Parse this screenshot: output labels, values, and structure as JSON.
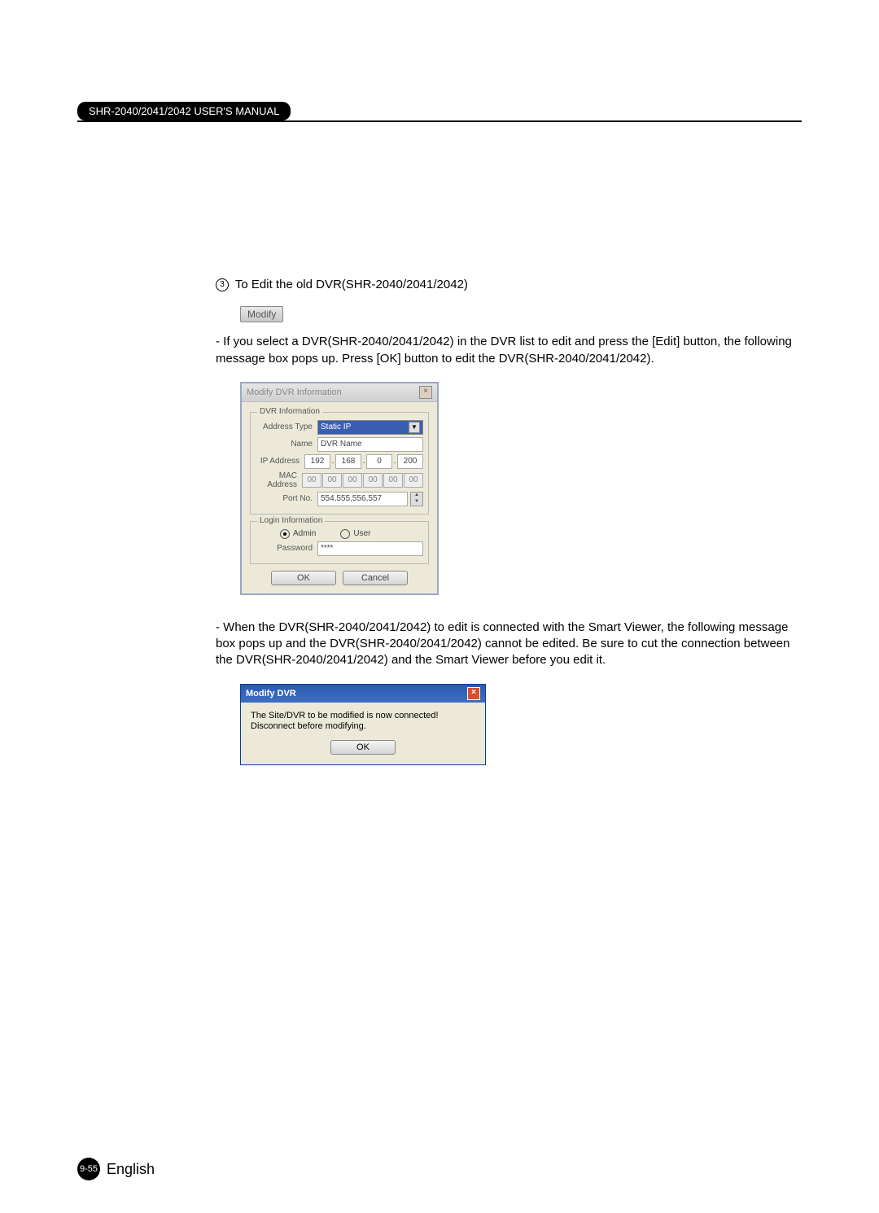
{
  "header": {
    "manual_title": "SHR-2040/2041/2042 USER'S MANUAL"
  },
  "section": {
    "step_number": "3",
    "step_title": "To Edit the old DVR(SHR-2040/2041/2042)",
    "modify_button_label": "Modify",
    "para1": "- If you select a DVR(SHR-2040/2041/2042) in the DVR list to edit and press the [Edit] button, the following message box pops up. Press [OK] button to edit the DVR(SHR-2040/2041/2042).",
    "para2": "- When the DVR(SHR-2040/2041/2042) to edit is connected with the Smart Viewer, the following message box pops up and the DVR(SHR-2040/2041/2042) cannot be edited. Be sure to cut the connection between the DVR(SHR-2040/2041/2042) and the Smart Viewer before you edit it."
  },
  "dialog1": {
    "title": "Modify DVR Information",
    "group1_legend": "DVR Information",
    "address_type_label": "Address Type",
    "address_type_value": "Static IP",
    "name_label": "Name",
    "name_value": "DVR Name",
    "ip_label": "IP Address",
    "ip": [
      "192",
      "168",
      "0",
      "200"
    ],
    "mac_label": "MAC Address",
    "mac": [
      "00",
      "00",
      "00",
      "00",
      "00",
      "00"
    ],
    "port_label": "Port No.",
    "port_value": "554,555,556,557",
    "group2_legend": "Login Information",
    "radio_admin": "Admin",
    "radio_user": "User",
    "password_label": "Password",
    "password_value": "****",
    "ok": "OK",
    "cancel": "Cancel"
  },
  "dialog2": {
    "title": "Modify DVR",
    "message_line1": "The Site/DVR to be modified is now connected!",
    "message_line2": "Disconnect before modifying.",
    "ok": "OK"
  },
  "footer": {
    "page": "9-55",
    "lang": "English"
  }
}
